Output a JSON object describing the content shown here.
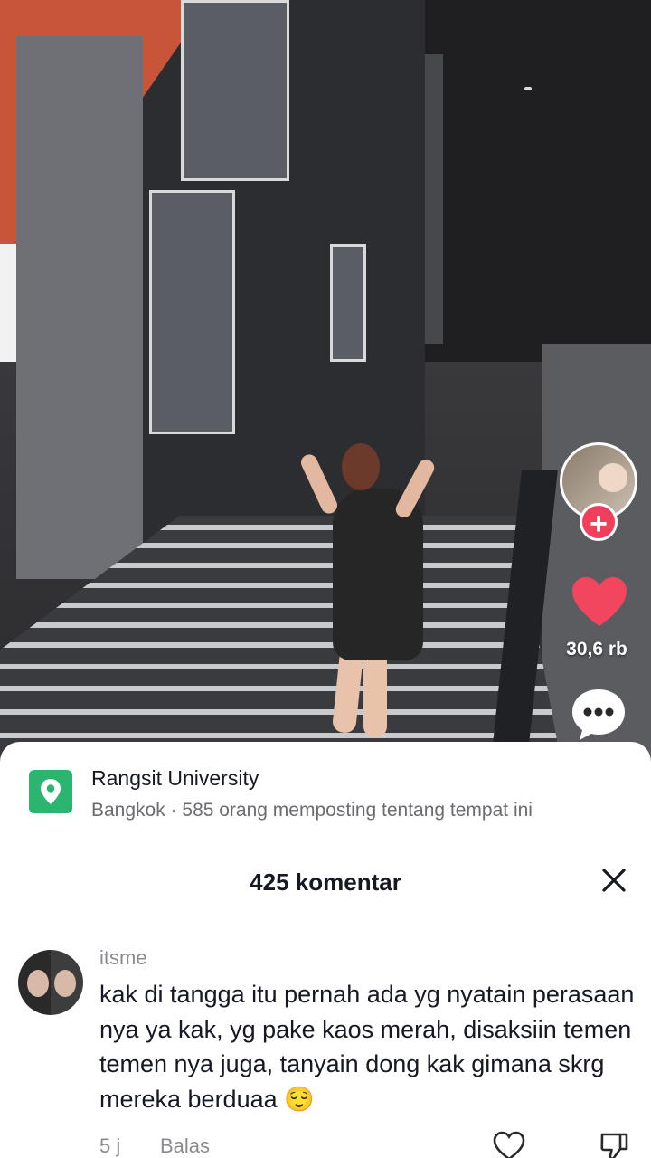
{
  "sidebar": {
    "like_count": "30,6 rb",
    "like_color": "#f2455e",
    "follow_color": "#ef3f5c"
  },
  "location": {
    "name": "Rangsit University",
    "subtitle": "Bangkok · 585 orang memposting tentang tempat ini",
    "icon": "map-pin-icon",
    "icon_color": "#2bb56f"
  },
  "comments": {
    "header": "425 komentar",
    "items": [
      {
        "username": "itsme",
        "text": "kak di tangga itu pernah ada yg nyatain perasaan nya ya kak, yg pake kaos merah, disaksiin temen temen nya juga, tanyain dong kak gimana skrg mereka berduaa 😌",
        "time": "5 j",
        "reply_label": "Balas"
      }
    ]
  }
}
